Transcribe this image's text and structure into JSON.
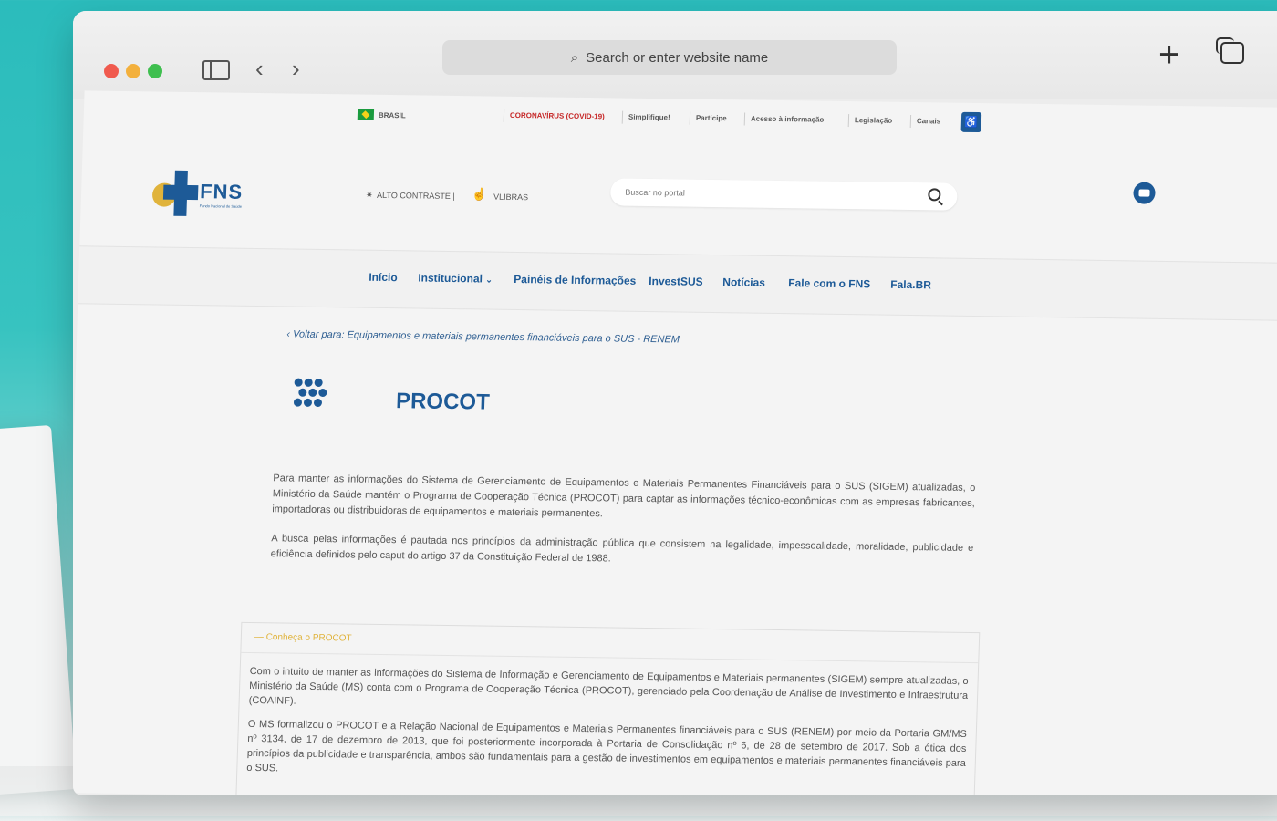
{
  "browser": {
    "address_placeholder": "Search or enter website name"
  },
  "govbar": {
    "country": "BRASIL",
    "links": [
      "CORONAVÍRUS (COVID-19)",
      "Simplifique!",
      "Participe",
      "Acesso à informação",
      "Legislação",
      "Canais"
    ]
  },
  "header": {
    "logo_text": "FNS",
    "logo_subtitle": "Fundo Nacional de Saúde",
    "high_contrast": "ALTO CONTRASTE |",
    "vlibras": "VLIBRAS",
    "search_placeholder": "Buscar no portal"
  },
  "nav": {
    "items": [
      "Início",
      "Institucional",
      "Painéis de Informações",
      "InvestSUS",
      "Notícias",
      "Fale com o FNS",
      "Fala.BR"
    ]
  },
  "content": {
    "back_link": "Voltar para: Equipamentos e materiais permanentes financiáveis para o SUS - RENEM",
    "title": "PROCOT",
    "paragraph1": "Para manter as informações do Sistema de Gerenciamento de Equipamentos e Materiais Permanentes Financiáveis para o SUS (SIGEM) atualizadas, o Ministério da Saúde mantém o Programa de Cooperação Técnica (PROCOT) para captar as informações técnico-econômicas com as empresas fabricantes, importadoras ou distribuidoras de equipamentos e materiais permanentes.",
    "paragraph2": "A busca pelas informações é pautada nos princípios da administração pública que consistem na legalidade, impessoalidade, moralidade, publicidade e eficiência definidos pelo caput do artigo 37 da Constituição Federal de 1988.",
    "accordion": {
      "title": "Conheça o PROCOT",
      "body1": "Com o intuito de manter as informações do Sistema de Informação e Gerenciamento de Equipamentos e Materiais permanentes (SIGEM) sempre atualizadas, o Ministério da Saúde (MS) conta com o Programa de Cooperação Técnica (PROCOT), gerenciado pela Coordenação de Análise de Investimento e Infraestrutura (COAINF).",
      "body2": "O MS formalizou o PROCOT e a Relação Nacional de Equipamentos e Materiais Permanentes financiáveis para o SUS (RENEM) por meio da Portaria GM/MS nº 3134, de 17 de dezembro de 2013, que foi posteriormente incorporada à Portaria de Consolidação nº 6, de 28 de setembro de 2017. Sob a ótica dos princípios da publicidade e transparência, ambos são fundamentais para a gestão de investimentos em equipamentos e materiais permanentes financiáveis para o SUS."
    }
  },
  "colors": {
    "brand_blue": "#1d5a97",
    "accent_yellow": "#e0b33b",
    "covid_red": "#c62828",
    "background_teal": "#2bbcbc"
  }
}
